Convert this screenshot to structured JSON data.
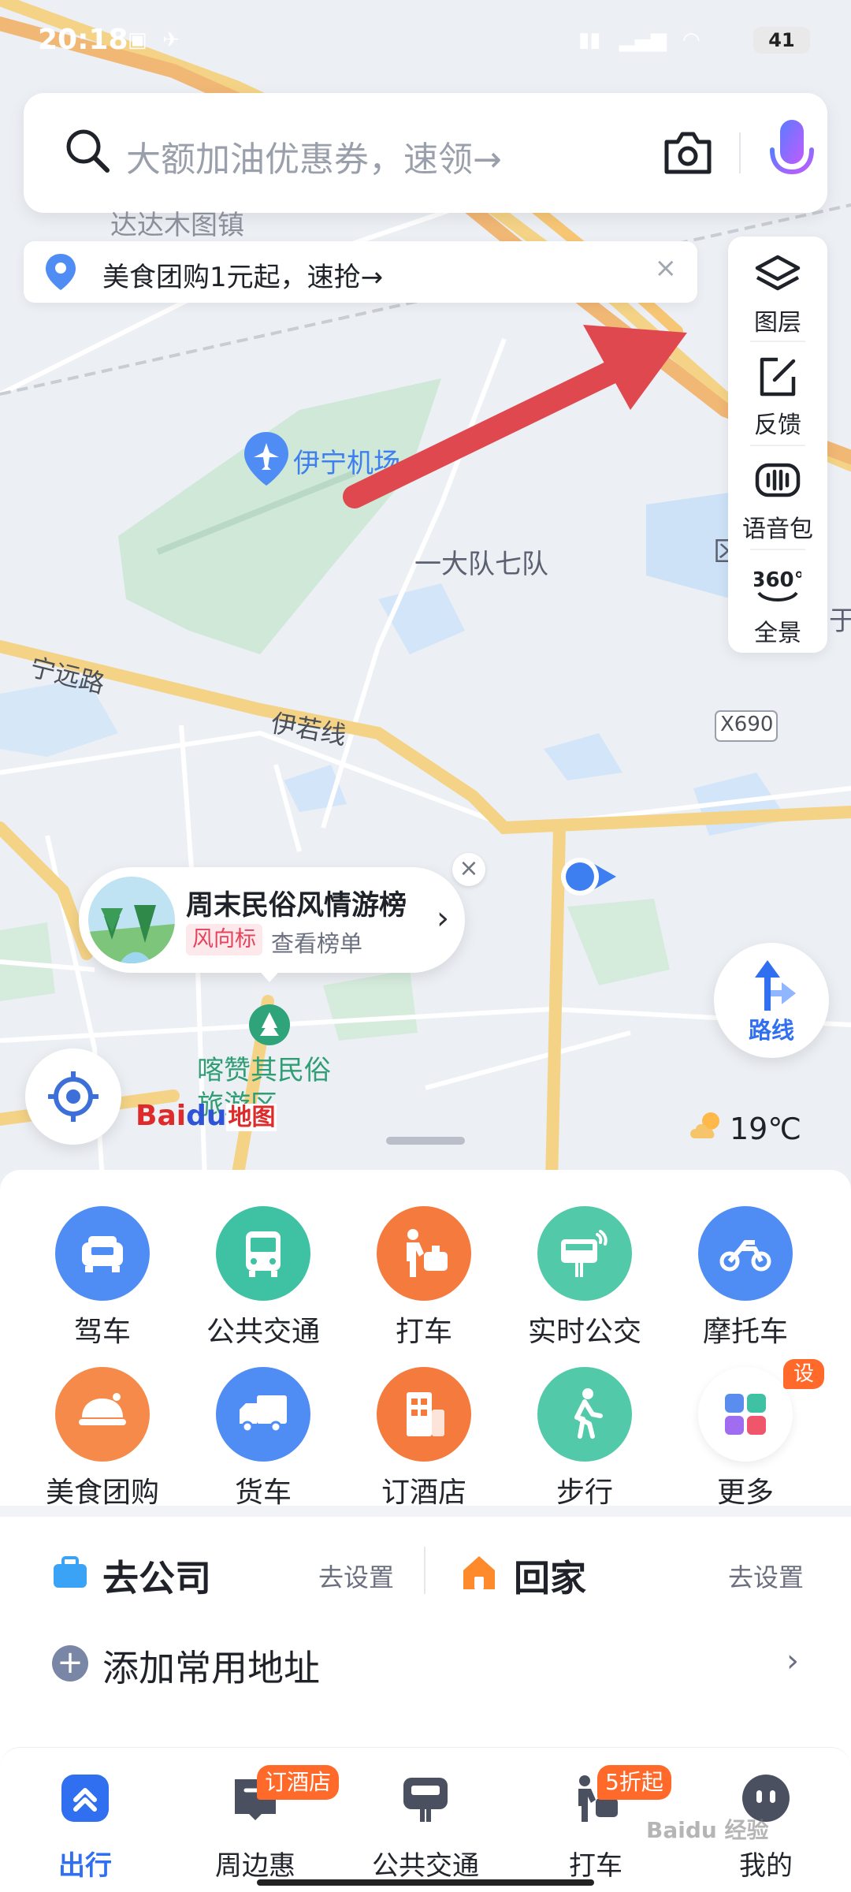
{
  "status_bar": {
    "time": "20:18",
    "battery": "41"
  },
  "search": {
    "placeholder": "大额加油优惠券，速领→"
  },
  "promo": {
    "peek_text": "达达木图镇",
    "text": "美食团购1元起，速抢→",
    "close": "×"
  },
  "right_tools": [
    {
      "label": "图层",
      "icon": "layers-icon"
    },
    {
      "label": "反馈",
      "icon": "feedback-icon"
    },
    {
      "label": "语音包",
      "icon": "voice-pack-icon"
    },
    {
      "label": "全景",
      "icon": "panorama-360-icon"
    }
  ],
  "map": {
    "labels": {
      "airport": "伊宁机场",
      "brigade": "一大队七队",
      "ningyuan_road": "宁远路",
      "yiruo_line": "伊若线",
      "x690": "X690",
      "folk_area": "喀赞其民俗\n旅游区",
      "edge_left": "区",
      "edge_right": "于"
    },
    "callout": {
      "title": "周末民俗风情游榜",
      "tag": "风向标",
      "subtitle": "查看榜单",
      "close": "×"
    },
    "route_label": "路线",
    "logo": {
      "part1": "Bai",
      "part2": "du",
      "part3": "地图"
    },
    "weather": {
      "temp": "19℃",
      "icon": "partly-cloudy-icon"
    }
  },
  "grid": [
    {
      "label": "驾车",
      "icon": "car-icon",
      "color": "#4f8df5"
    },
    {
      "label": "公共交通",
      "icon": "bus-icon",
      "color": "#3fc1a3"
    },
    {
      "label": "打车",
      "icon": "taxi-icon",
      "color": "#f57a3d"
    },
    {
      "label": "实时公交",
      "icon": "realtime-bus-icon",
      "color": "#52c9a8"
    },
    {
      "label": "摩托车",
      "icon": "motorcycle-icon",
      "color": "#4f8df5"
    },
    {
      "label": "美食团购",
      "icon": "food-icon",
      "color": "#f58a4a"
    },
    {
      "label": "货车",
      "icon": "truck-icon",
      "color": "#4f8df5"
    },
    {
      "label": "订酒店",
      "icon": "hotel-icon",
      "color": "#f57a3d"
    },
    {
      "label": "步行",
      "icon": "walk-icon",
      "color": "#52c9a8"
    },
    {
      "label": "更多",
      "icon": "more-grid-icon",
      "color": "#ffffff",
      "badge": "设置"
    }
  ],
  "shortcuts": {
    "company": {
      "label": "去公司",
      "action": "去设置"
    },
    "home": {
      "label": "回家",
      "action": "去设置"
    },
    "add": {
      "label": "添加常用地址",
      "chevron": "›"
    }
  },
  "bottom_nav": [
    {
      "label": "出行",
      "icon": "travel-icon",
      "active": true
    },
    {
      "label": "周边惠",
      "icon": "nearby-deals-icon",
      "badge": "订酒店"
    },
    {
      "label": "公共交通",
      "icon": "transit-icon"
    },
    {
      "label": "打车",
      "icon": "taxi-nav-icon",
      "badge": "5折起"
    },
    {
      "label": "我的",
      "icon": "profile-icon"
    }
  ],
  "watermark": "Baidu 经验",
  "colors": {
    "accent": "#2f6ff0",
    "annotation_arrow": "#e0484f",
    "badge": "#ff6a2b"
  }
}
